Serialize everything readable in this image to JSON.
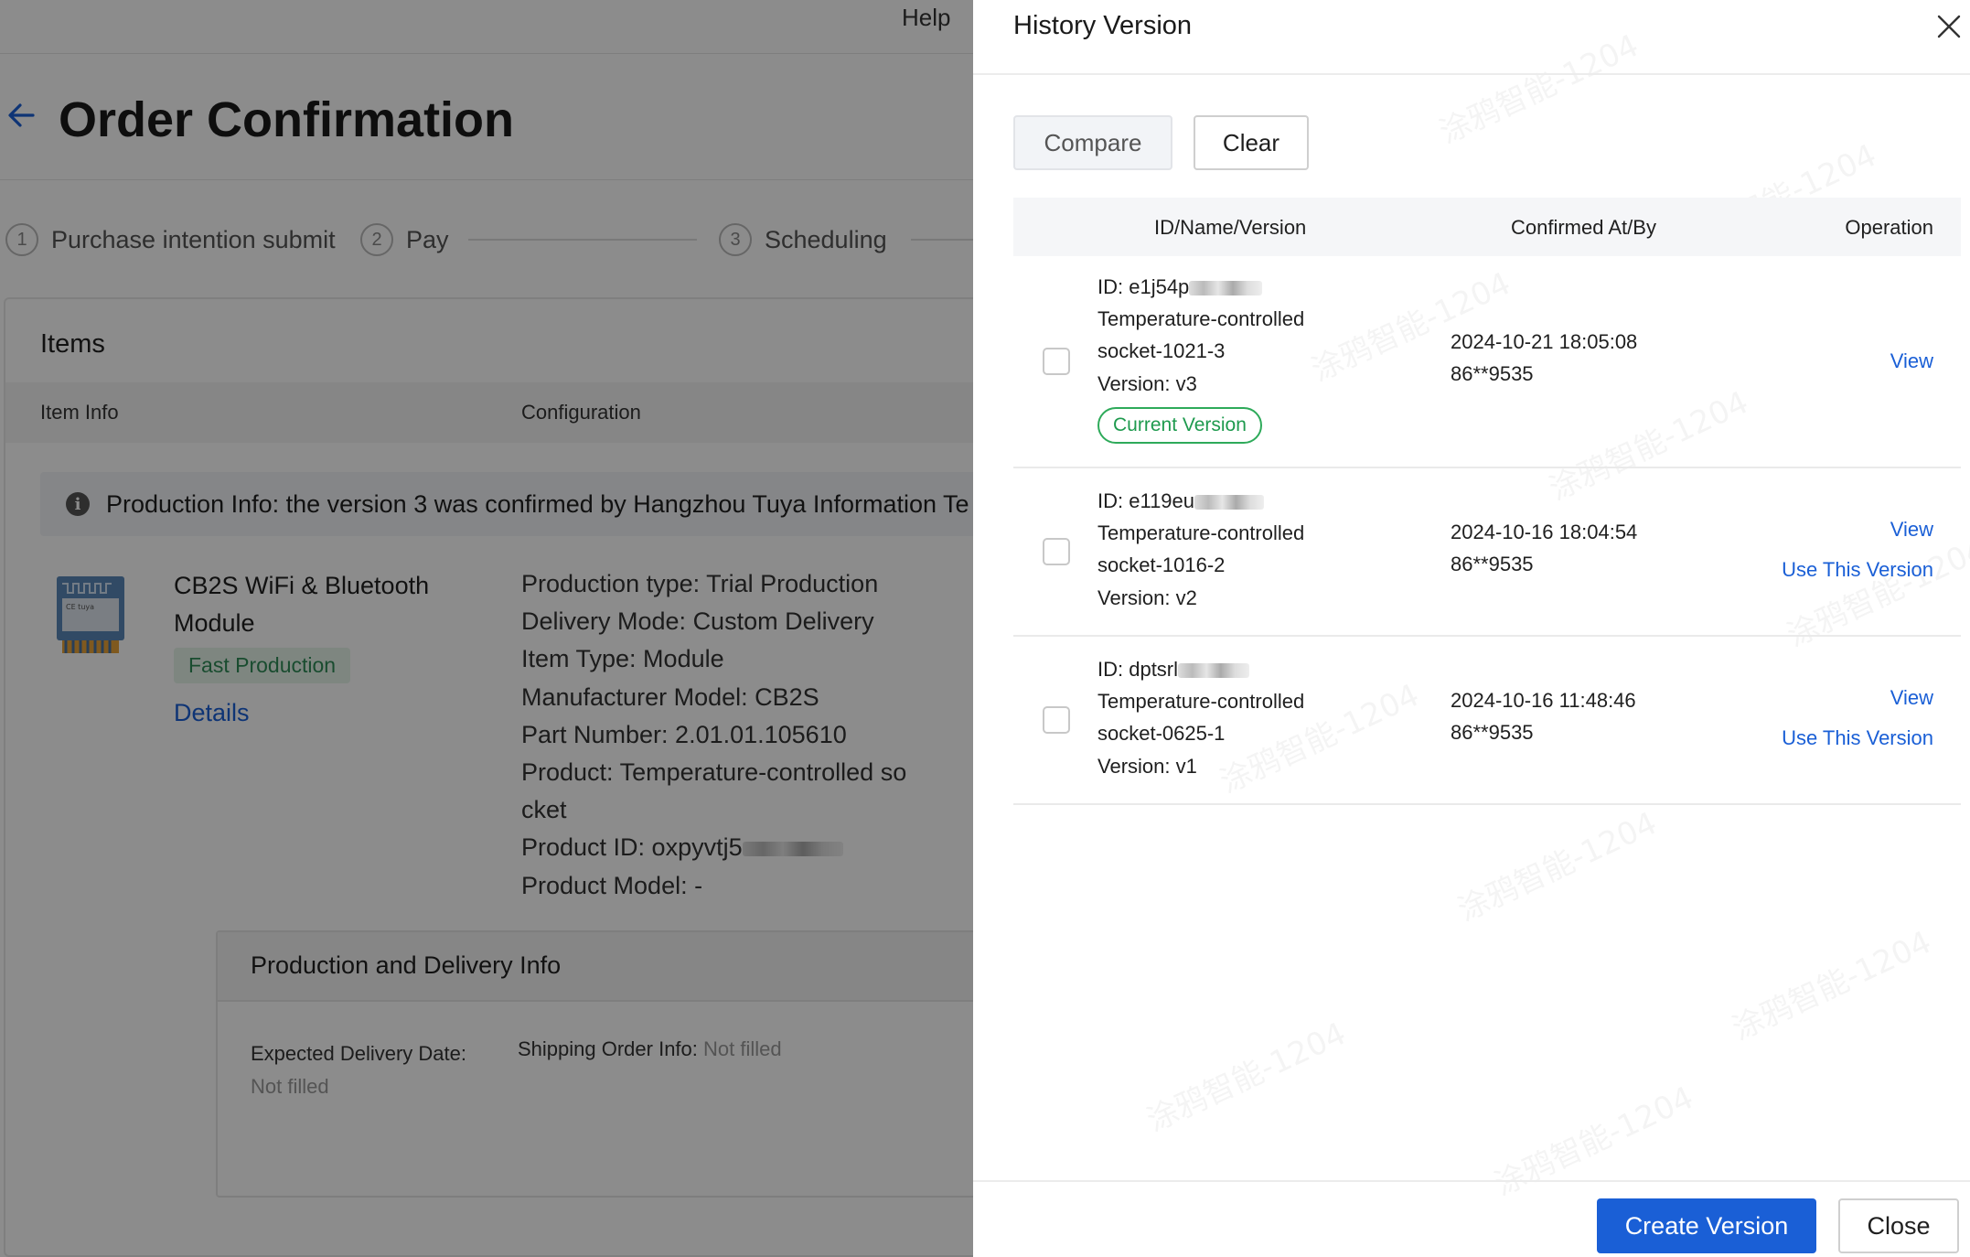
{
  "background": {
    "help_label": "Help",
    "page_title": "Order Confirmation",
    "steps": [
      {
        "num": "1",
        "label": "Purchase intention submit"
      },
      {
        "num": "2",
        "label": "Pay"
      },
      {
        "num": "3",
        "label": "Scheduling"
      }
    ],
    "items_title": "Items",
    "columns": {
      "item_info": "Item Info",
      "configuration": "Configuration"
    },
    "alert_text": "Production Info: the version 3 was confirmed by Hangzhou Tuya Information Te",
    "product": {
      "name": "CB2S WiFi & Bluetooth Module",
      "tag": "Fast Production",
      "details_link": "Details"
    },
    "config": [
      "Production type: Trial Production",
      "Delivery Mode: Custom Delivery",
      "Item Type: Module",
      "Manufacturer Model: CB2S",
      "Part Number: 2.01.01.105610",
      "Product: Temperature-controlled so",
      "cket",
      "Product ID: oxpyvtj5",
      "Product Model: -"
    ],
    "delivery": {
      "title": "Production and Delivery Info",
      "expected_label": "Expected Delivery Date:",
      "expected_value": "Not filled",
      "shipping_label": "Shipping Order Info:",
      "shipping_value": "Not filled"
    }
  },
  "drawer": {
    "title": "History Version",
    "compare_label": "Compare",
    "clear_label": "Clear",
    "headers": {
      "id_name_version": "ID/Name/Version",
      "confirmed": "Confirmed At/By",
      "operation": "Operation"
    },
    "rows": [
      {
        "id": "ID: e1j54p",
        "name_line1": "Temperature-controlled",
        "name_line2": "socket-1021-3",
        "version": "Version: v3",
        "current_tag": "Current Version",
        "confirmed_at": "2024-10-21 18:05:08",
        "confirmed_by": "86**9535",
        "view": "View"
      },
      {
        "id": "ID: e119eu",
        "name_line1": "Temperature-controlled",
        "name_line2": "socket-1016-2",
        "version": "Version: v2",
        "confirmed_at": "2024-10-16 18:04:54",
        "confirmed_by": "86**9535",
        "view": "View",
        "use_version": "Use This Version"
      },
      {
        "id": "ID: dptsrl",
        "name_line1": "Temperature-controlled",
        "name_line2": "socket-0625-1",
        "version": "Version: v1",
        "confirmed_at": "2024-10-16 11:48:46",
        "confirmed_by": "86**9535",
        "view": "View",
        "use_version": "Use This Version"
      }
    ],
    "create_label": "Create Version",
    "close_label": "Close",
    "watermark": "涂鸦智能-1204"
  },
  "colors": {
    "accent": "#1a5fd6",
    "success": "#2eaa5a",
    "overlay": "rgba(0,0,0,0.45)"
  },
  "icons": [
    "arrow-left-icon",
    "info-icon",
    "close-icon",
    "module-image"
  ]
}
